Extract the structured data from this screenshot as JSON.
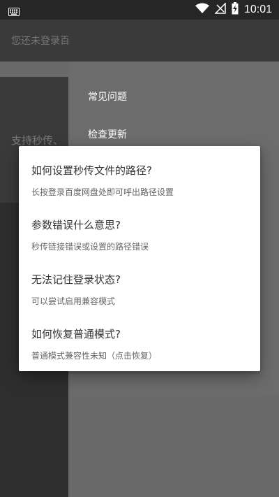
{
  "status_bar": {
    "time": "10:01",
    "icons": [
      "keyboard-icon",
      "wifi-icon",
      "no-signal-icon",
      "battery-charging-icon"
    ]
  },
  "app": {
    "title_partial": "您还未登录百度",
    "main_text_partial": "支持秒传、"
  },
  "menu": {
    "items": [
      "常见问题",
      "检查更新"
    ]
  },
  "dialog": {
    "faqs": [
      {
        "q": "如何设置秒传文件的路径?",
        "a": "长按登录百度网盘处即可呼出路径设置"
      },
      {
        "q": "参数错误什么意思?",
        "a": "秒传链接错误或设置的路径错误"
      },
      {
        "q": "无法记住登录状态?",
        "a": "可以尝试启用兼容模式"
      },
      {
        "q": "如何恢复普通模式?",
        "a": "普通模式兼容性未知（点击恢复）"
      }
    ]
  },
  "colors": {
    "status_bar": "#262626",
    "scrim": "#6c6c6c",
    "dialog_bg": "#ffffff",
    "question_text": "#333333",
    "answer_text": "#666666"
  }
}
